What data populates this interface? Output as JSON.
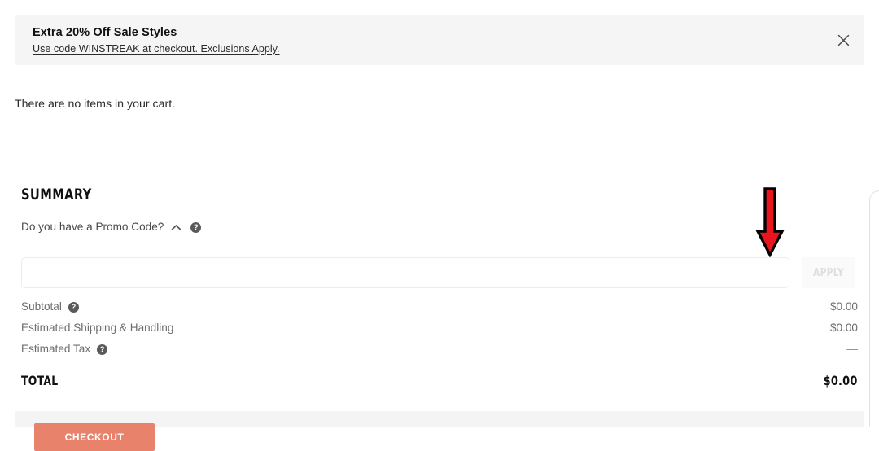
{
  "banner": {
    "title": "Extra 20% Off Sale Styles",
    "subtitle": "Use code WINSTREAK at checkout. Exclusions Apply.",
    "close_icon": "close-icon",
    "background_color": "#f5f5f5"
  },
  "cart": {
    "empty_message": "There are no items in your cart."
  },
  "summary": {
    "heading": "SUMMARY",
    "promo_toggle_label": "Do you have a Promo Code?",
    "promo_chevron_icon": "chevron-up-icon",
    "promo_help_icon": "help-circle-icon",
    "promo_input_value": "",
    "promo_input_placeholder": "",
    "apply_label": "APPLY",
    "rows": [
      {
        "label": "Subtotal",
        "value": "$0.00",
        "has_help": true
      },
      {
        "label": "Estimated Shipping & Handling",
        "value": "$0.00",
        "has_help": false
      },
      {
        "label": "Estimated Tax",
        "value": "—",
        "has_help": true
      }
    ],
    "total_label": "TOTAL",
    "total_value": "$0.00"
  },
  "checkout": {
    "button_label": "CHECKOUT",
    "button_color": "#e8826b",
    "panel_color": "#f4f4f4"
  },
  "annotation": {
    "arrow_icon": "down-arrow-annotation",
    "arrow_fill": "#e8141e",
    "arrow_stroke": "#000000"
  }
}
